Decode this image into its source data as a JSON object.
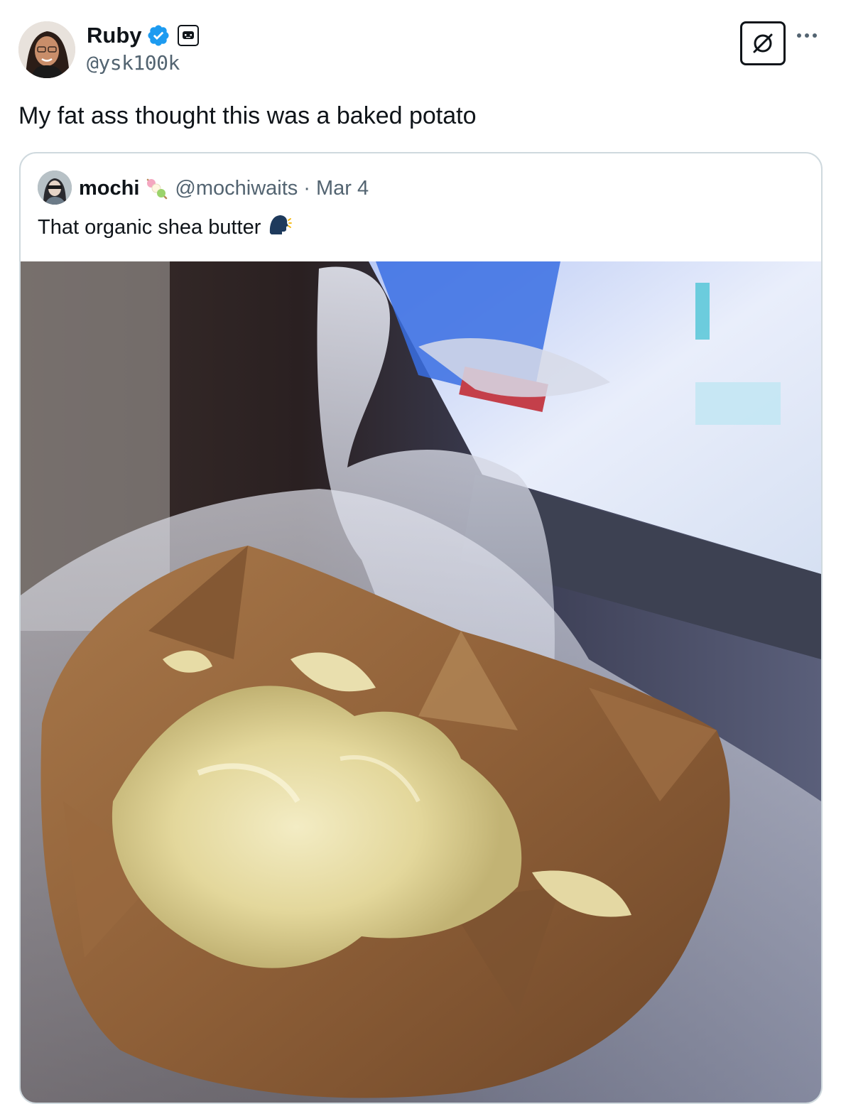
{
  "author": {
    "name": "Ruby",
    "handle": "@ysk100k",
    "avatar_icon": "profile-photo",
    "verified": true,
    "badge_icon": "bot-badge-icon"
  },
  "tweet": {
    "text": "My fat ass thought this was a baked potato"
  },
  "actions": {
    "grok_icon": "grok-icon",
    "more_icon": "more-options-icon"
  },
  "quoted": {
    "name": "mochi",
    "name_emoji": "dango-emoji",
    "handle": "@mochiwaits",
    "separator": "·",
    "date": "Mar 4",
    "text": "That organic shea butter",
    "text_emoji": "speaking-head-emoji",
    "media": "photo of shea butter in wrinkled brown wrapping inside a plastic bag"
  },
  "colors": {
    "text": "#0f1419",
    "secondary": "#536471",
    "verified_blue": "#1d9bf0",
    "border": "#cfd9de"
  }
}
